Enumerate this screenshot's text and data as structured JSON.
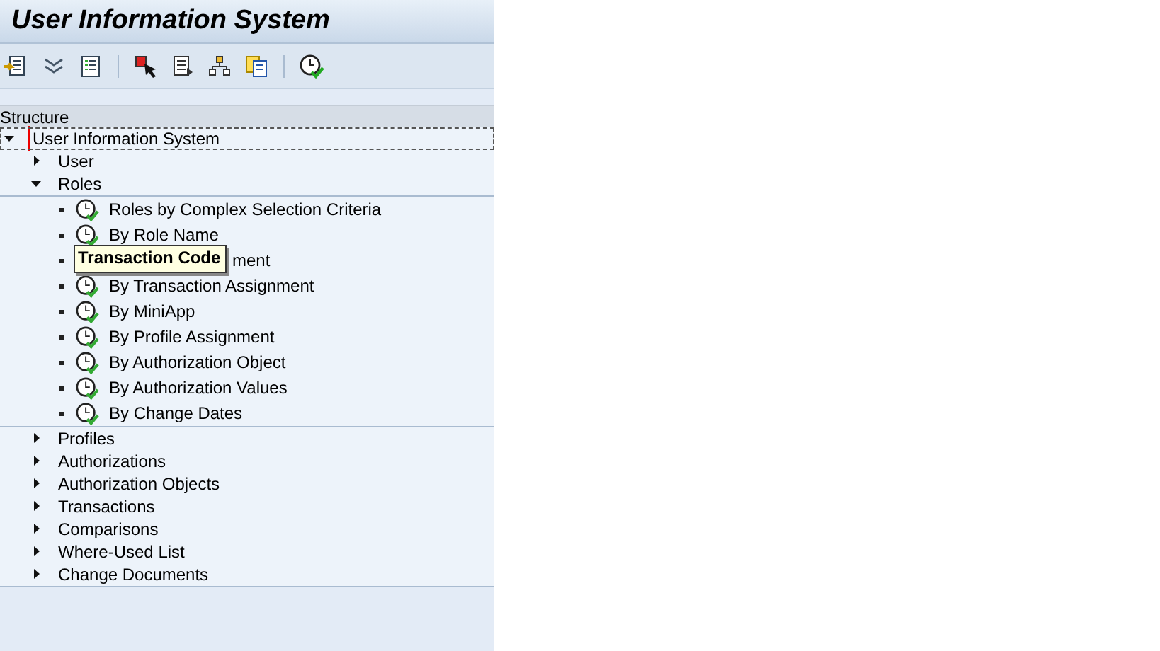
{
  "window": {
    "title": "User Information System"
  },
  "structure": {
    "heading": "Structure",
    "tree": [
      {
        "label": "User Information System",
        "expanded": true,
        "selected": true,
        "children": [
          {
            "label": "User",
            "expanded": false,
            "selected": false
          },
          {
            "label": "Roles",
            "expanded": true,
            "selected": false,
            "children": [
              {
                "kind": "report",
                "label": "Roles by Complex Selection Criteria",
                "selected": false
              },
              {
                "kind": "report",
                "label": "By Role Name",
                "selected": false
              },
              {
                "kind": "report",
                "label": "ment",
                "selected": false,
                "covered": true
              },
              {
                "kind": "report",
                "label": "By Transaction Assignment",
                "selected": false
              },
              {
                "kind": "report",
                "label": "By MiniApp",
                "selected": false
              },
              {
                "kind": "report",
                "label": "By Profile Assignment",
                "selected": false
              },
              {
                "kind": "report",
                "label": "By Authorization Object",
                "selected": false
              },
              {
                "kind": "report",
                "label": "By Authorization Values",
                "selected": false
              },
              {
                "kind": "report",
                "label": "By Change Dates",
                "selected": false
              }
            ]
          },
          {
            "label": "Profiles",
            "expanded": false,
            "selected": false
          },
          {
            "label": "Authorizations",
            "expanded": false,
            "selected": false
          },
          {
            "label": "Authorization Objects",
            "expanded": false,
            "selected": false
          },
          {
            "label": "Transactions",
            "expanded": false,
            "selected": false
          },
          {
            "label": "Comparisons",
            "expanded": false,
            "selected": false
          },
          {
            "label": "Where-Used List",
            "expanded": false,
            "selected": false
          },
          {
            "label": "Change Documents",
            "expanded": false,
            "selected": false
          }
        ]
      }
    ]
  },
  "tooltip": {
    "text": "Transaction Code"
  }
}
